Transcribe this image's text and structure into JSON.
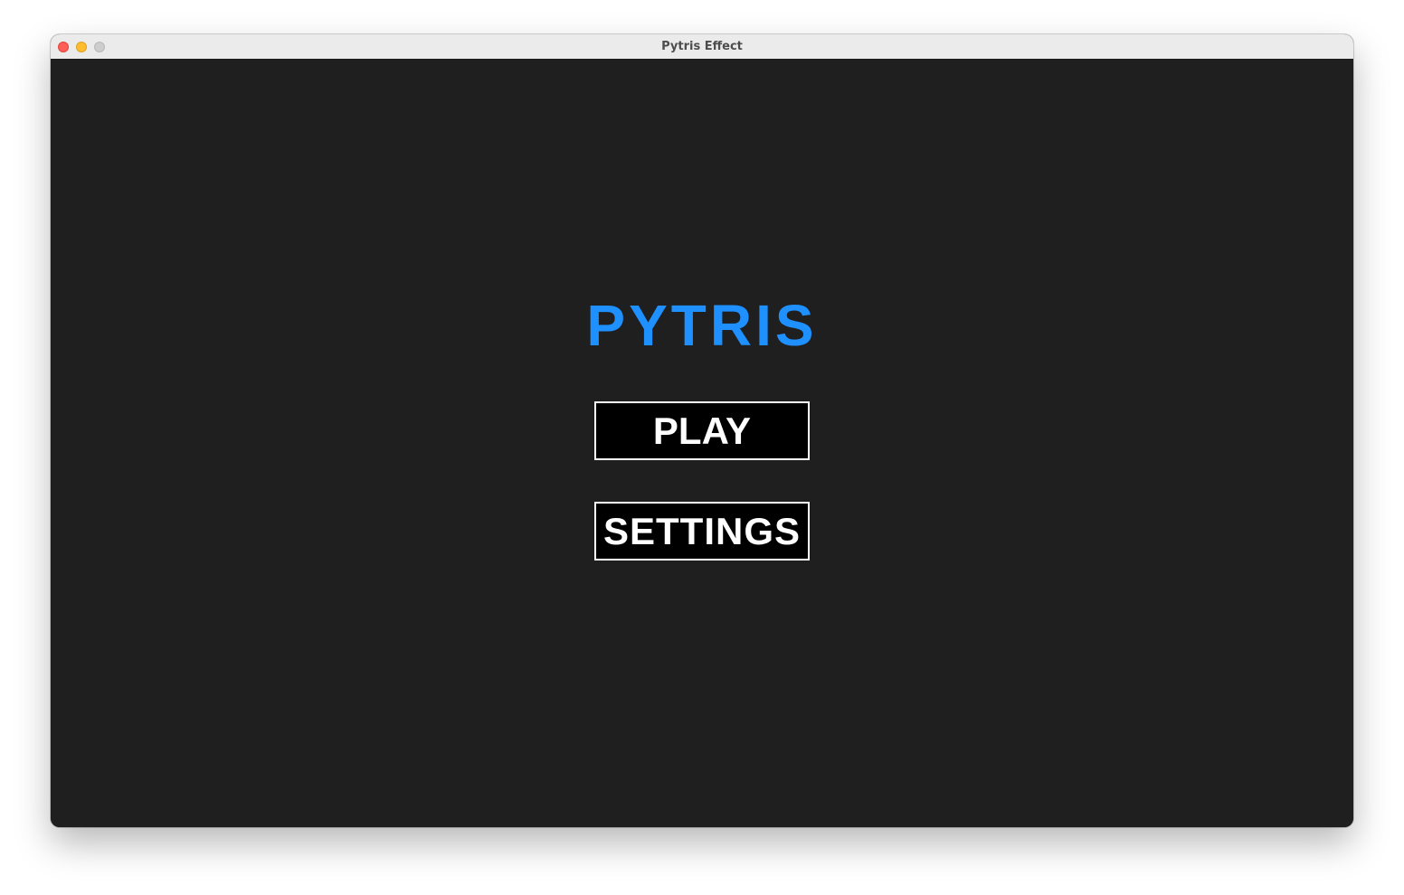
{
  "window": {
    "title": "Pytris Effect"
  },
  "game": {
    "title": "PYTRIS",
    "title_color": "#1e90ff"
  },
  "menu": {
    "play_label": "PLAY",
    "settings_label": "SETTINGS"
  },
  "colors": {
    "background": "#1f1f1f",
    "button_background": "#000000",
    "button_border": "#ffffff"
  }
}
